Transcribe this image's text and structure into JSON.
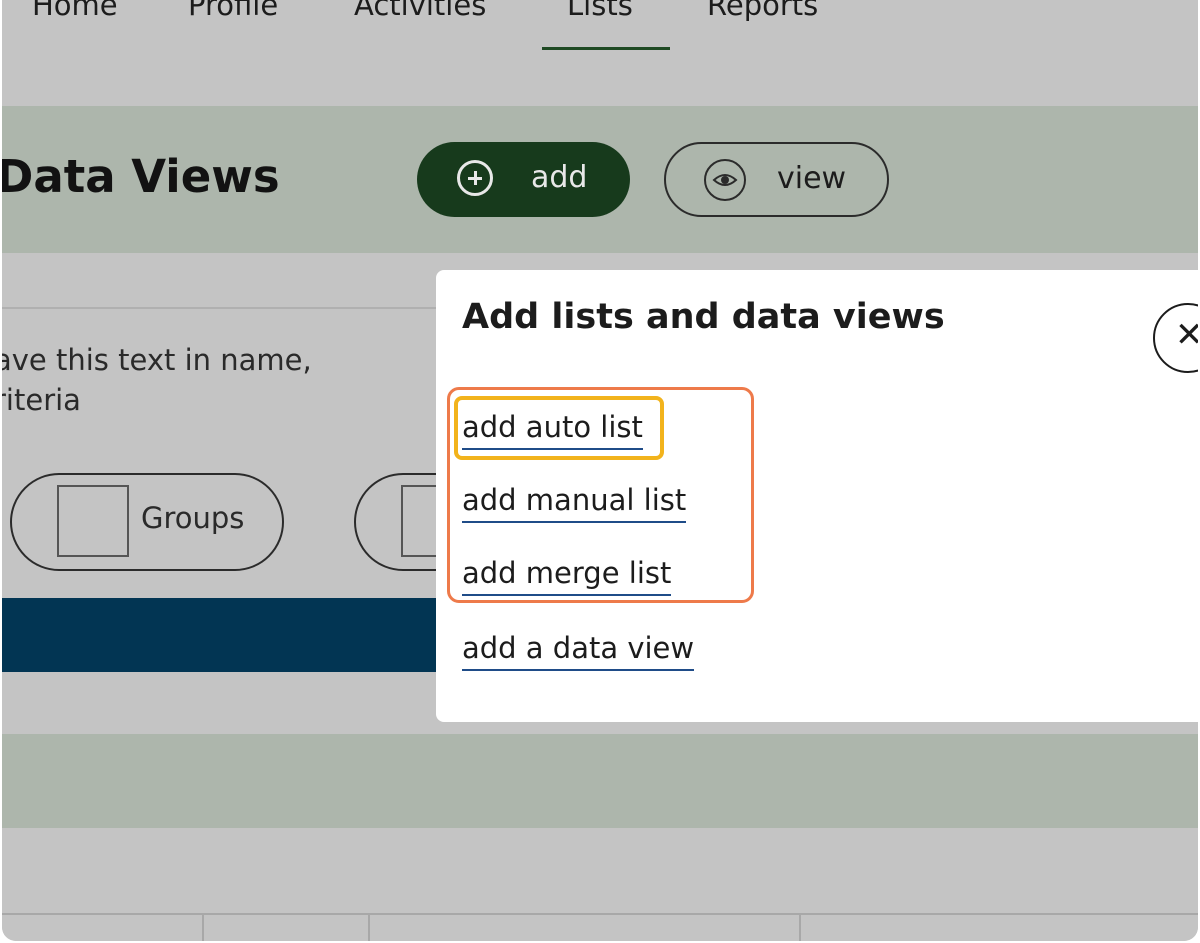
{
  "nav": {
    "items": [
      "Home",
      "Profile",
      "Activities",
      "Lists",
      "Reports"
    ],
    "active": "Lists"
  },
  "header": {
    "title": "Data Views",
    "add_label": "add",
    "view_label": "view"
  },
  "filters": {
    "help_line1": "ave this text in name,",
    "help_line2": "riteria",
    "groups_label": "Groups"
  },
  "modal": {
    "title": "Add lists and data views",
    "close_glyph": "✕",
    "links": {
      "auto": "add auto list",
      "manual": "add manual list",
      "merge": "add merge list",
      "data_view": "add a data view"
    }
  },
  "icons": {
    "add": "plus-circle-icon",
    "view": "eye-icon",
    "close": "close-icon"
  },
  "colors": {
    "accent_dark_green": "#173a1c",
    "header_band": "#adb6ac",
    "blue_bar": "#023553",
    "group_highlight": "#ee7a4a",
    "item_highlight": "#f2b31c",
    "link_underline": "#1f4c88"
  }
}
